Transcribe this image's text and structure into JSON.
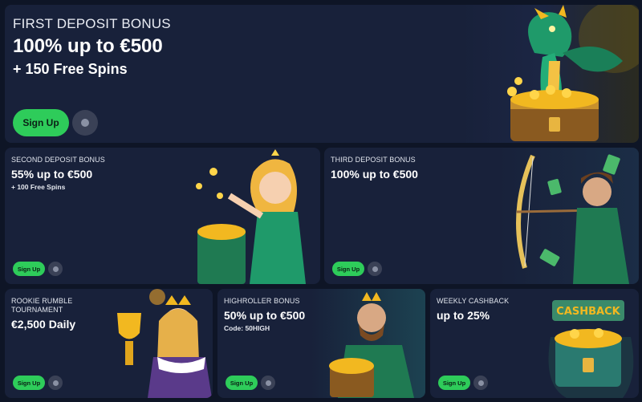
{
  "hero": {
    "kicker": "FIRST DEPOSIT BONUS",
    "title": "100% up to €500",
    "subtitle": "+ 150 Free Spins",
    "cta_label": "Sign Up",
    "info_icon": "info-icon"
  },
  "cards": [
    {
      "kicker": "SECOND DEPOSIT BONUS",
      "title": "55% up to €500",
      "subtitle": "+ 100 Free Spins",
      "cta_label": "Sign Up"
    },
    {
      "kicker": "THIRD DEPOSIT BONUS",
      "title": "100% up to €500",
      "subtitle": "",
      "cta_label": "Sign Up"
    },
    {
      "kicker_line1": "ROOKIE RUMBLE",
      "kicker_line2": "TOURNAMENT",
      "title": "€2,500 Daily",
      "cta_label": "Sign Up"
    },
    {
      "kicker": "HIGHROLLER BONUS",
      "title": "50% up to €500",
      "subtitle": "Code: 50HIGH",
      "cta_label": "Sign Up"
    },
    {
      "kicker": "WEEKLY CASHBACK",
      "title": "up to 25%",
      "subtitle": "",
      "cta_label": "Sign Up",
      "art_text": "CASHBACK"
    }
  ],
  "colors": {
    "background": "#0e1526",
    "card": "#18213a",
    "accent_green": "#2ecc5a",
    "info_gray": "#3a4156",
    "gold": "#f2b820"
  }
}
